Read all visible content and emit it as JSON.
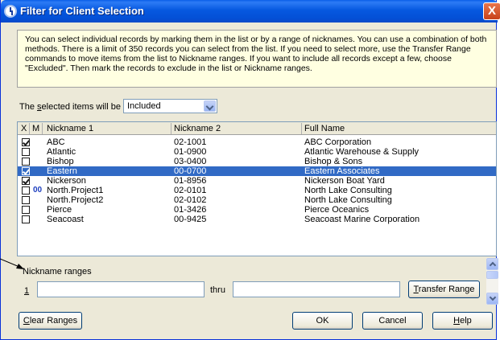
{
  "window": {
    "title": "Filter for Client Selection",
    "close_glyph": "X"
  },
  "info_text": "You can select individual records by marking them in the list or by a range of nicknames. You can use a combination of both methods. There is a limit of 350 records you can select from the list. If you need to select more, use the Transfer Range commands to move items from the list to Nickname ranges. If you want to include all records except a few, choose \"Excluded\". Then mark the records to exclude in the list or Nickname ranges.",
  "selection": {
    "label_pre": "The ",
    "label_mnemonic": "s",
    "label_post": "elected items will be",
    "value": "Included"
  },
  "grid": {
    "columns": [
      "X",
      "M",
      "Nickname 1",
      "Nickname 2",
      "Full Name"
    ],
    "rows": [
      {
        "checked": true,
        "marked": false,
        "nick1": "ABC",
        "nick2": "02-1001",
        "full": "ABC Corporation",
        "selected": false
      },
      {
        "checked": false,
        "marked": false,
        "nick1": "Atlantic",
        "nick2": "01-0900",
        "full": "Atlantic Warehouse & Supply",
        "selected": false
      },
      {
        "checked": false,
        "marked": false,
        "nick1": "Bishop",
        "nick2": "03-0400",
        "full": "Bishop & Sons",
        "selected": false
      },
      {
        "checked": true,
        "marked": false,
        "nick1": "Eastern",
        "nick2": "00-0700",
        "full": "Eastern Associates",
        "selected": true
      },
      {
        "checked": true,
        "marked": false,
        "nick1": "Nickerson",
        "nick2": "01-8956",
        "full": "Nickerson Boat Yard",
        "selected": false
      },
      {
        "checked": false,
        "marked": true,
        "nick1": "North.Project1",
        "nick2": "02-0101",
        "full": "North Lake Consulting",
        "selected": false
      },
      {
        "checked": false,
        "marked": false,
        "nick1": "North.Project2",
        "nick2": "02-0102",
        "full": "North Lake Consulting",
        "selected": false
      },
      {
        "checked": false,
        "marked": false,
        "nick1": "Pierce",
        "nick2": "01-3426",
        "full": "Pierce Oceanics",
        "selected": false
      },
      {
        "checked": false,
        "marked": false,
        "nick1": "Seacoast",
        "nick2": "00-9425",
        "full": "Seacoast Marine Corporation",
        "selected": false
      }
    ],
    "marker_glyph": "00"
  },
  "ranges": {
    "label": "Nickname ranges",
    "row_number": "1",
    "thru_label": "thru",
    "from_value": "",
    "to_value": "",
    "transfer_button_mnemonic": "T",
    "transfer_button_rest": "ransfer Range"
  },
  "buttons": {
    "clear_mnemonic": "C",
    "clear_rest": "lear Ranges",
    "ok": "OK",
    "cancel": "Cancel",
    "help_mnemonic": "H",
    "help_rest": "elp"
  },
  "colors": {
    "titlebar": "#0658e0",
    "info_background": "#ffffe1",
    "selection_highlight": "#316ac5",
    "dialog_face": "#ece9d8"
  }
}
